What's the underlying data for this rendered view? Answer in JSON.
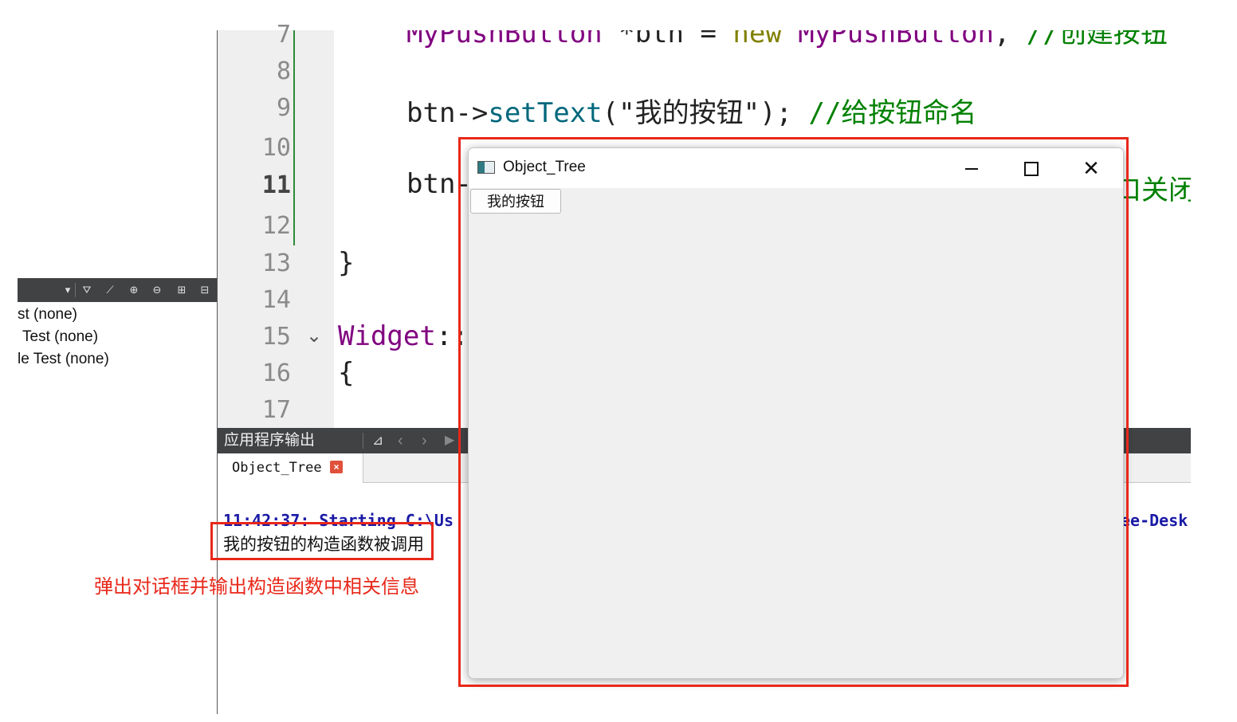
{
  "tests_panel": {
    "items": [
      "st (none)",
      "Test (none)",
      "le Test (none)"
    ],
    "toolbar_icons": [
      "dropdown-arrow-icon",
      "filter-icon",
      "leaf-icon",
      "expand-all-icon",
      "collapse-all-icon",
      "split-add-icon",
      "close-pane-icon"
    ]
  },
  "editor": {
    "line_numbers": [
      "7",
      "8",
      "9",
      "10",
      "11",
      "12",
      "13",
      "14",
      "15",
      "16",
      "17"
    ],
    "current_line": "11",
    "fold_marker": "⌄",
    "lines": {
      "l7": {
        "a": "MyPushButton",
        "b": " *btn = ",
        "c": "new",
        "d": " MyPushButton",
        "e": ", ",
        "f": "//创建按钮"
      },
      "l9": {
        "a": "btn->",
        "b": "setText",
        "c": "(\"我的按钮\"); ",
        "d": "//给按钮命名"
      },
      "l11": {
        "a": "btn->",
        "tail": "口关闭"
      },
      "l13": {
        "a": "}"
      },
      "l15": {
        "a": "Widget",
        "b": "::"
      },
      "l16": {
        "a": "{"
      }
    }
  },
  "output": {
    "pane_title": "应用程序输出",
    "tab_label": "Object_Tree",
    "tab_close": "×",
    "start_line": "11:42:37: Starting C:\\Us",
    "start_line_tail": "ee-Desk",
    "message": "我的按钮的构造函数被调用"
  },
  "annotation": "弹出对话框并输出构造函数中相关信息",
  "app_window": {
    "title": "Object_Tree",
    "button_label": "我的按钮",
    "close_glyph": "✕"
  },
  "colors": {
    "highlight": "#e8281a",
    "toolbar": "#404244",
    "gutter": "#efefef"
  }
}
